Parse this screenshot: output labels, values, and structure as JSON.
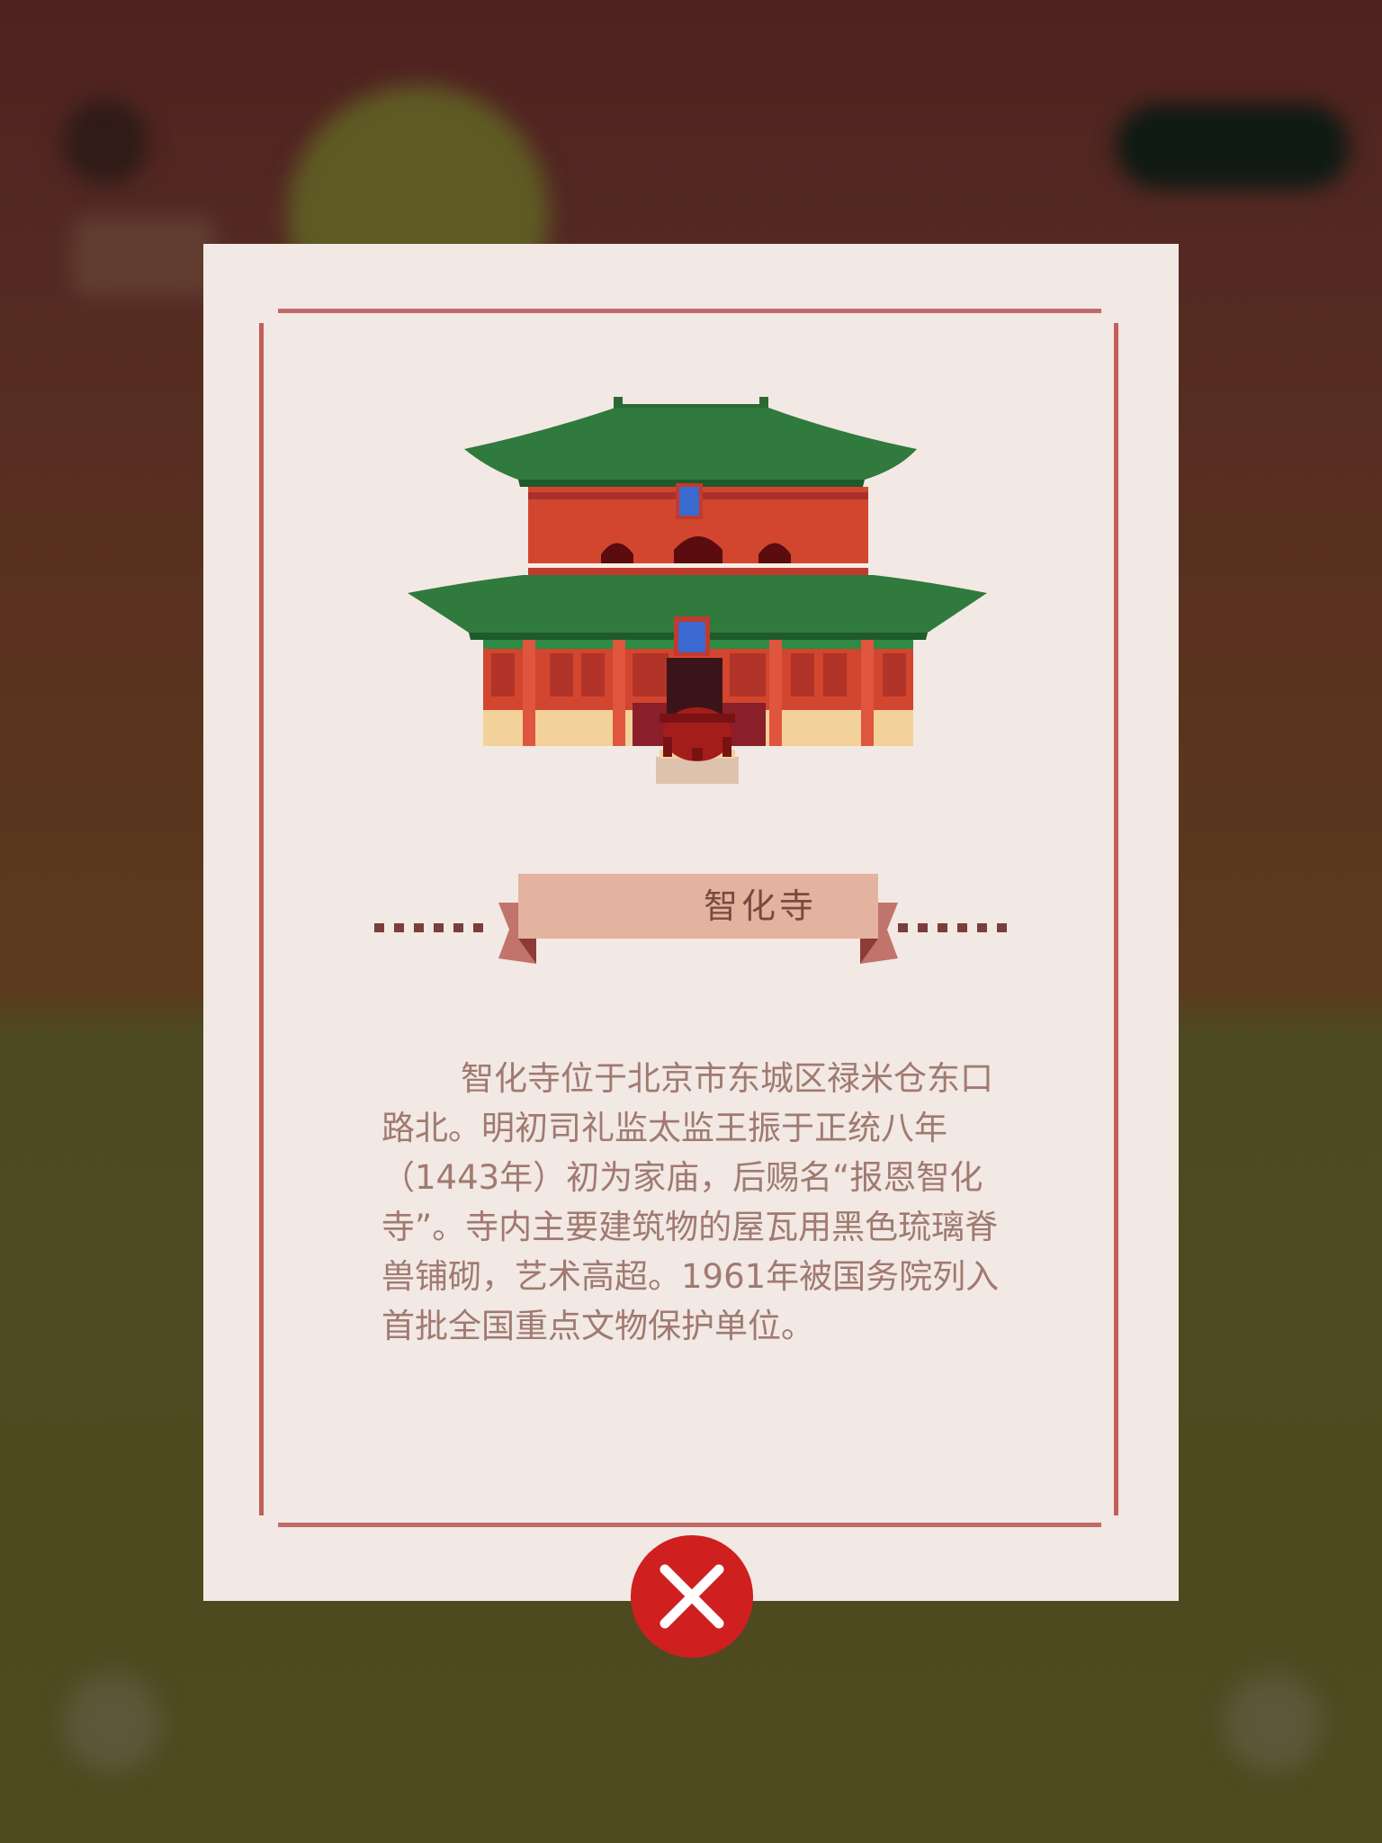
{
  "card": {
    "title": "智化寺",
    "description": "智化寺位于北京市东城区禄米仓东口路北。明初司礼监太监王振于正统八年（1443年）初为家庙，后赐名“报恩智化寺”。寺内主要建筑物的屋瓦用黑色琉璃脊兽铺砌，艺术高超。1961年被国务院列入首批全国重点文物保护单位。",
    "illustration": "temple-illustration"
  },
  "close_button": {
    "icon": "close-icon"
  },
  "colors": {
    "card_bg": "#f2e8e4",
    "frame": "#c45e5a",
    "ribbon": "#e3b3a0",
    "close": "#cf1f1f",
    "roof": "#2f7a3c",
    "walls": "#d2462f"
  }
}
